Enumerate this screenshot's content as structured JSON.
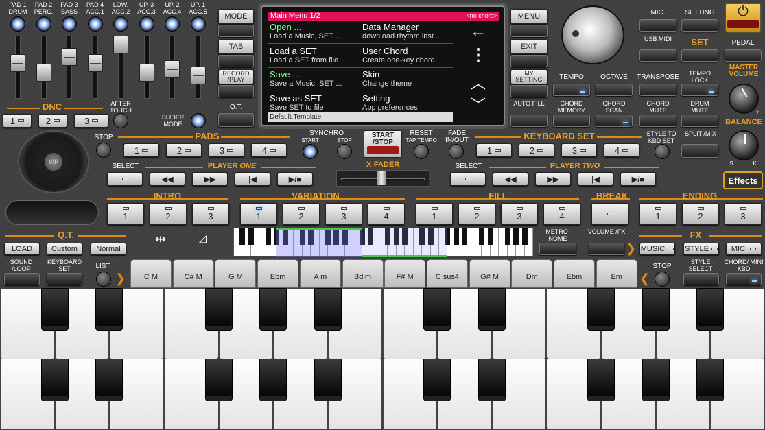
{
  "colors": {
    "accent": "#e08a10",
    "screen_header": "#e0105a"
  },
  "faders": [
    "PAD 1 DRUM",
    "PAD 2 PERC.",
    "PAD 3 BASS",
    "PAD 4 ACC.1",
    "LOW. ACC.2",
    "UP. 3 ACC.3",
    "UP. 2 ACC.4",
    "UP. 1 ACC.5"
  ],
  "left": {
    "dnc": "DNC",
    "after_touch": "AFTER TOUCH",
    "slider_mode": "SLIDER MODE",
    "dnc_buttons": [
      "1",
      "2",
      "3"
    ]
  },
  "top_buttons": {
    "mode": "MODE",
    "tab": "TAB",
    "record": "RECORD /PLAY",
    "qt": "Q.T.",
    "menu": "MENU",
    "exit": "EXIT",
    "my_setting": "MY SETTING",
    "auto_fill": "AUTO FILL"
  },
  "screen": {
    "title": "Main Menu  1/2",
    "chord_status": "<no chord>",
    "footer": "Default.Template",
    "items": [
      {
        "title": "Open ...",
        "sub": "Load a Music, SET ..."
      },
      {
        "title": "Data Manager",
        "sub": "download rhythm,inst..."
      },
      {
        "title": "Load a SET",
        "sub": "Load a SET from file"
      },
      {
        "title": "User Chord",
        "sub": "Create one-key chord"
      },
      {
        "title": "Save ...",
        "sub": "Save a Music, SET ..."
      },
      {
        "title": "Skin",
        "sub": "Change theme"
      },
      {
        "title": "Save as SET",
        "sub": "Save SET to file"
      },
      {
        "title": "Setting",
        "sub": "App preferences"
      }
    ],
    "nav": {
      "back": "←",
      "more": "⋮",
      "up": "︿",
      "down": "﹀"
    }
  },
  "right": {
    "mic": "MIC.",
    "setting": "SETTING",
    "power_icon": "⏻",
    "usb_midi": "USB MIDI",
    "set": "SET",
    "pedal": "PEDAL",
    "tempo": "TEMPO",
    "octave": "OCTAVE",
    "transpose": "TRANSPOSE",
    "tempo_lock": "TEMPO LOCK",
    "master_volume": "MASTER VOLUME",
    "chord_memory": "CHORD MEMORY",
    "chord_scan": "CHORD SCAN",
    "chord_mute": "CHORD MUTE",
    "drum_mute": "DRUM MUTE",
    "balance": "BALANCE",
    "balance_s": "S",
    "balance_k": "K",
    "minus": "−",
    "plus": "+",
    "style_to_kbd": "STYLE TO KBD SET",
    "split_mix": "SPLIT /MIX",
    "effects": "Effects"
  },
  "pads": {
    "label": "PADS",
    "stop": "STOP",
    "buttons": [
      "1",
      "2",
      "3",
      "4"
    ],
    "synchro": "SYNCHRO",
    "synchro_start": "START",
    "synchro_stop": "STOP",
    "start_stop": "START /STOP",
    "reset": "RESET",
    "tap_tempo": "TAP TEMPO",
    "fade": "FADE IN/OUT"
  },
  "keyboard_set": {
    "label": "KEYBOARD SET",
    "buttons": [
      "1",
      "2",
      "3",
      "4"
    ]
  },
  "player_one": {
    "select": "SELECT",
    "label_a": "PLAYER ",
    "label_b": "ONE"
  },
  "player_two": {
    "select": "SELECT",
    "label_a": "PLAYER ",
    "label_b": "TWO"
  },
  "xfader": "X-FADER",
  "transport": [
    "◀◀",
    "▶▶",
    "|◀",
    "▶/■"
  ],
  "intro": {
    "label": "INTRO",
    "buttons": [
      "1",
      "2",
      "3"
    ]
  },
  "variation": {
    "label": "VARIATION",
    "buttons": [
      "1",
      "2",
      "3",
      "4"
    ]
  },
  "fill": {
    "label": "FILL",
    "buttons": [
      "1",
      "2",
      "3",
      "4"
    ]
  },
  "break": {
    "label": "BREAK"
  },
  "ending": {
    "label": "ENDING",
    "buttons": [
      "1",
      "2",
      "3"
    ]
  },
  "qt": {
    "label": "Q.T.",
    "load": "LOAD",
    "custom": "Custom",
    "normal": "Normal"
  },
  "bottom_left": {
    "sound_loop": "SOUND /LOOP",
    "keyboard_set": "KEYBOARD SET",
    "list": "LIST"
  },
  "metronome": "METRO- NOME",
  "volume_fx": "VOLUME /FX",
  "fx": {
    "label": "FX",
    "music": "MUSIC",
    "style": "STYLE",
    "mic": "MIC."
  },
  "stop_right": "STOP",
  "style_select": "STYLE SELECT",
  "chord_mini": "CHORD/ MINI KBD",
  "chords": [
    "C M",
    "C# M",
    "G M",
    "Ebm",
    "A m",
    "Bdim",
    "F# M",
    "C sus4",
    "G# M",
    "Dm",
    "Ebm",
    "Em"
  ]
}
